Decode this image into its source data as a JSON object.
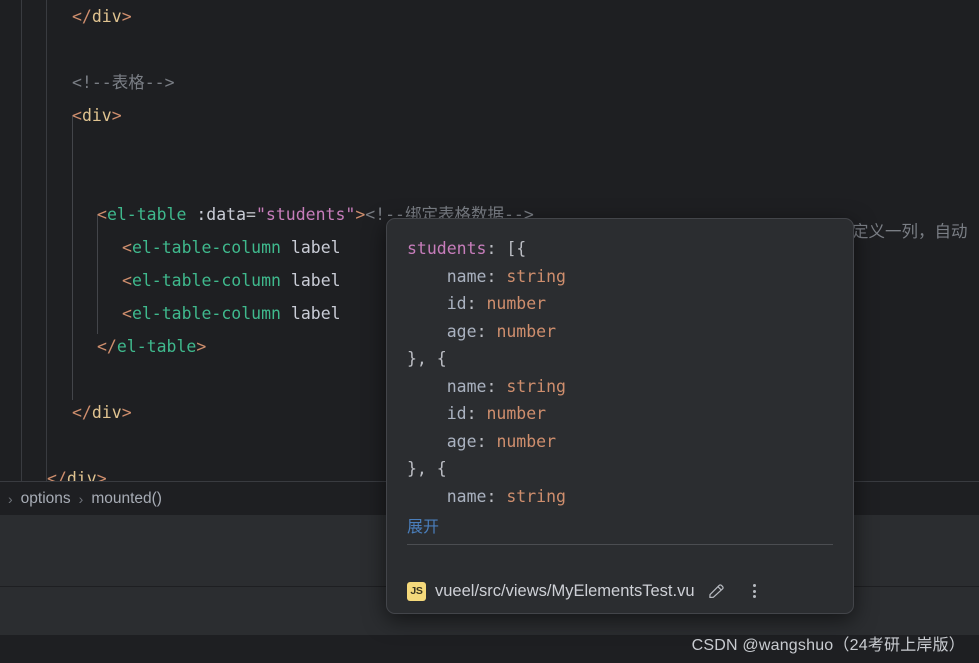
{
  "editor": {
    "lines": [
      {
        "indent": 72,
        "segments": [
          {
            "t": "bracket",
            "v": "</"
          },
          {
            "t": "tag",
            "v": "div"
          },
          {
            "t": "bracket",
            "v": ">"
          }
        ]
      },
      {
        "indent": 72,
        "segments": []
      },
      {
        "indent": 72,
        "segments": [
          {
            "t": "comment",
            "v": "<!--表格-->"
          }
        ]
      },
      {
        "indent": 72,
        "segments": [
          {
            "t": "bracket",
            "v": "<"
          },
          {
            "t": "tag",
            "v": "div"
          },
          {
            "t": "bracket",
            "v": ">"
          }
        ]
      },
      {
        "indent": 72,
        "segments": []
      },
      {
        "indent": 72,
        "segments": []
      },
      {
        "indent": 97,
        "segments": [
          {
            "t": "bracket",
            "v": "<"
          },
          {
            "t": "comp",
            "v": "el-table"
          },
          {
            "t": "plain",
            "v": " "
          },
          {
            "t": "attr",
            "v": ":data"
          },
          {
            "t": "eq",
            "v": "="
          },
          {
            "t": "str",
            "v": "\"students\""
          },
          {
            "t": "bracket",
            "v": ">"
          },
          {
            "t": "comment",
            "v": "<!--绑定表格数据-->"
          }
        ]
      },
      {
        "indent": 122,
        "segments": [
          {
            "t": "bracket",
            "v": "<"
          },
          {
            "t": "comp",
            "v": "el-table-column"
          },
          {
            "t": "plain",
            "v": " "
          },
          {
            "t": "attr",
            "v": "label"
          }
        ]
      },
      {
        "indent": 122,
        "segments": [
          {
            "t": "bracket",
            "v": "<"
          },
          {
            "t": "comp",
            "v": "el-table-column"
          },
          {
            "t": "plain",
            "v": " "
          },
          {
            "t": "attr",
            "v": "label"
          }
        ]
      },
      {
        "indent": 122,
        "segments": [
          {
            "t": "bracket",
            "v": "<"
          },
          {
            "t": "comp",
            "v": "el-table-column"
          },
          {
            "t": "plain",
            "v": " "
          },
          {
            "t": "attr",
            "v": "label"
          }
        ]
      },
      {
        "indent": 97,
        "segments": [
          {
            "t": "bracket",
            "v": "</"
          },
          {
            "t": "comp",
            "v": "el-table"
          },
          {
            "t": "bracket",
            "v": ">"
          }
        ]
      },
      {
        "indent": 72,
        "segments": []
      },
      {
        "indent": 72,
        "segments": [
          {
            "t": "bracket",
            "v": "</"
          },
          {
            "t": "tag",
            "v": "div"
          },
          {
            "t": "bracket",
            "v": ">"
          }
        ]
      },
      {
        "indent": 72,
        "segments": []
      },
      {
        "indent": 47,
        "segments": [
          {
            "t": "bracket",
            "v": "</"
          },
          {
            "t": "tag",
            "v": "div"
          },
          {
            "t": "bracket",
            "v": ">"
          }
        ]
      }
    ],
    "right_comment": "定义一列，自动"
  },
  "breadcrumb": {
    "leading_chevron": "›",
    "separator": "›",
    "items": [
      {
        "label": "options"
      },
      {
        "label": "mounted()"
      }
    ]
  },
  "doc_popup": {
    "type_lines": [
      [
        {
          "c": "key",
          "v": "students"
        },
        {
          "c": "punct",
          "v": ": [{"
        }
      ],
      [
        {
          "c": "punct",
          "v": "    "
        },
        {
          "c": "prop",
          "v": "name"
        },
        {
          "c": "punct",
          "v": ": "
        },
        {
          "c": "type",
          "v": "string"
        }
      ],
      [
        {
          "c": "punct",
          "v": "    "
        },
        {
          "c": "prop",
          "v": "id"
        },
        {
          "c": "punct",
          "v": ": "
        },
        {
          "c": "type",
          "v": "number"
        }
      ],
      [
        {
          "c": "punct",
          "v": "    "
        },
        {
          "c": "prop",
          "v": "age"
        },
        {
          "c": "punct",
          "v": ": "
        },
        {
          "c": "type",
          "v": "number"
        }
      ],
      [
        {
          "c": "punct",
          "v": "}, {"
        }
      ],
      [
        {
          "c": "punct",
          "v": "    "
        },
        {
          "c": "prop",
          "v": "name"
        },
        {
          "c": "punct",
          "v": ": "
        },
        {
          "c": "type",
          "v": "string"
        }
      ],
      [
        {
          "c": "punct",
          "v": "    "
        },
        {
          "c": "prop",
          "v": "id"
        },
        {
          "c": "punct",
          "v": ": "
        },
        {
          "c": "type",
          "v": "number"
        }
      ],
      [
        {
          "c": "punct",
          "v": "    "
        },
        {
          "c": "prop",
          "v": "age"
        },
        {
          "c": "punct",
          "v": ": "
        },
        {
          "c": "type",
          "v": "number"
        }
      ],
      [
        {
          "c": "punct",
          "v": "}, {"
        }
      ],
      [
        {
          "c": "punct",
          "v": "    "
        },
        {
          "c": "prop",
          "v": "name"
        },
        {
          "c": "punct",
          "v": ": "
        },
        {
          "c": "type",
          "v": "string"
        }
      ]
    ],
    "expand_label": "展开",
    "file_badge": "JS",
    "file_path": "vueel/src/views/MyElementsTest.vu",
    "edit_icon": "pencil-icon",
    "more_icon": "kebab-menu-icon"
  },
  "watermark": {
    "text": "CSDN @wangshuo（24考研上岸版）"
  },
  "colors": {
    "editor_bg": "#1e1f22",
    "popup_bg": "#2b2d30",
    "panel_bg": "#2b2d30",
    "accent_link": "#4a7ebb",
    "badge_js": "#f5d97b",
    "tag_orange": "#cf8e6d",
    "component_teal": "#3fb98d",
    "string_pink": "#c77dbb",
    "comment_gray": "#7a7e85",
    "type_orange": "#cf8e6d"
  }
}
